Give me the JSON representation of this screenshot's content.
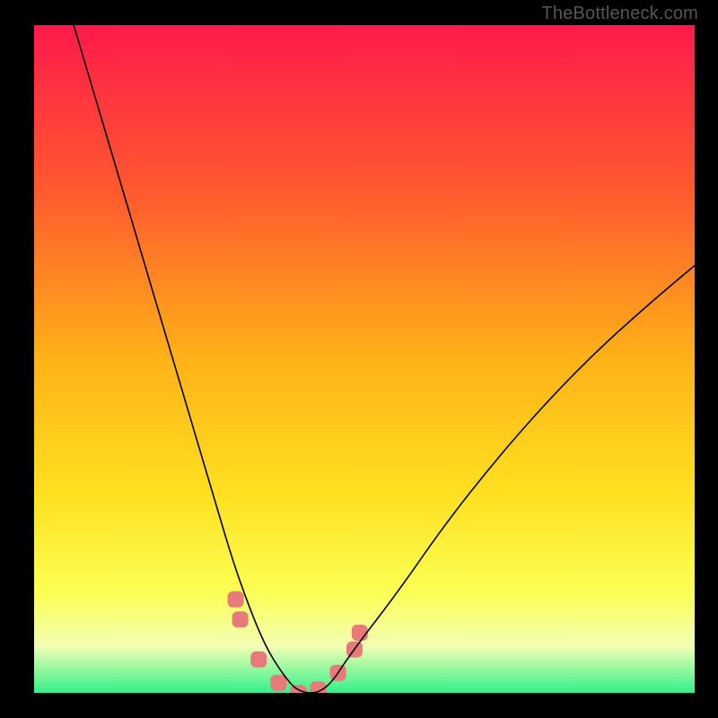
{
  "watermark": "TheBottleneck.com",
  "gradient": {
    "top": "#ff1a4b",
    "p25": "#ff5a2e",
    "p50": "#ffb218",
    "p70": "#ffe020",
    "p85": "#fbff54",
    "p93": "#f3ffb4",
    "bottom": "#34f08a"
  },
  "chart_data": {
    "type": "line",
    "title": "",
    "xlabel": "",
    "ylabel": "",
    "xlim": [
      0,
      100
    ],
    "ylim": [
      0,
      100
    ],
    "series": [
      {
        "name": "bottleneck-curve",
        "x": [
          6,
          9,
          12,
          15,
          18,
          21,
          24,
          27,
          30,
          32.5,
          35,
          37.5,
          40,
          44,
          48,
          55,
          62,
          70,
          78,
          86,
          94,
          100
        ],
        "values": [
          100,
          90,
          80,
          70,
          60,
          50,
          40,
          30,
          20,
          13,
          7,
          3,
          0,
          0,
          6,
          15,
          25,
          35,
          44,
          52,
          59,
          64
        ]
      }
    ],
    "markers": {
      "name": "highlight-points",
      "color": "#e97a7a",
      "radius": 9,
      "x": [
        30.5,
        31.2,
        34,
        37,
        40,
        43,
        46,
        48.5,
        49.3
      ],
      "values": [
        14,
        11,
        5,
        1.5,
        0,
        0.5,
        3,
        6.5,
        9
      ]
    }
  }
}
